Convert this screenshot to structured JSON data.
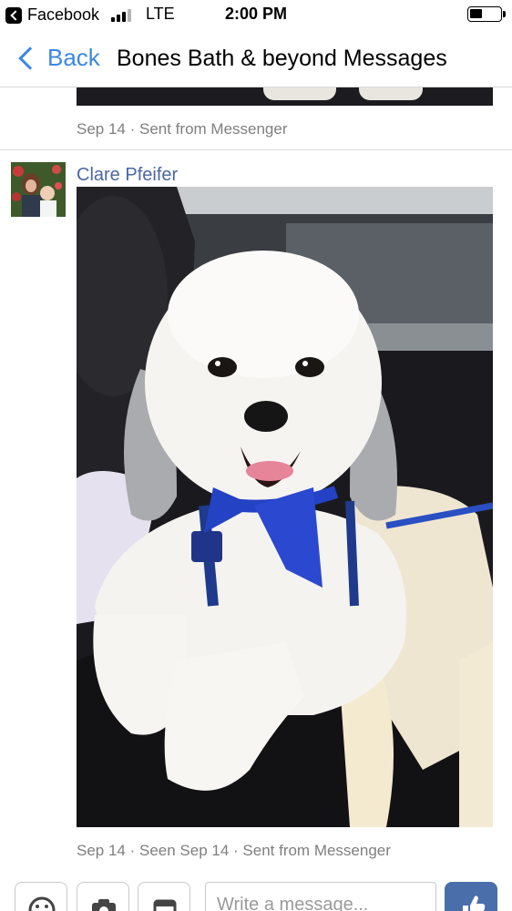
{
  "status_bar": {
    "app_name": "Facebook",
    "carrier": "LTE",
    "time": "2:00 PM",
    "battery_level": 0.4
  },
  "nav": {
    "back_label": "Back",
    "title": "Bones Bath & beyond Messages"
  },
  "messages": [
    {
      "meta": "Sep 14 · Sent from Messenger"
    },
    {
      "sender": "Clare Pfeifer",
      "meta": "Sep 14 · Seen Sep 14 · Sent from Messenger"
    }
  ],
  "composer": {
    "placeholder": "Write a message...",
    "buttons": [
      "emoji-icon",
      "camera-icon",
      "sticker-icon"
    ],
    "send_button": "thumbs-up-icon"
  },
  "colors": {
    "link_blue": "#3b88e8",
    "name_blue": "#4b67a1",
    "like_button": "#4a6ea9",
    "meta_gray": "#7f7f7f"
  }
}
